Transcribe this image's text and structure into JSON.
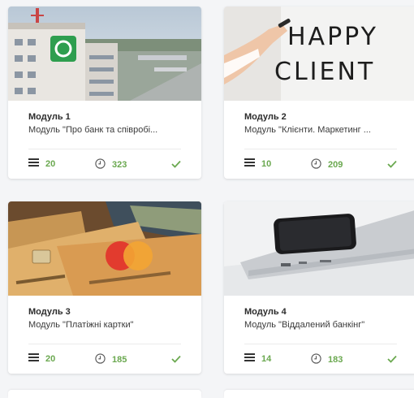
{
  "accent_color": "#6aa84f",
  "modules": [
    {
      "title": "Модуль 1",
      "subtitle": "Модуль \"Про банк та співробі...",
      "lessons": "20",
      "minutes": "323",
      "image": "bank-building-photo",
      "completed": true
    },
    {
      "title": "Модуль 2",
      "subtitle": "Модуль \"Клієнти. Маркетинг ...",
      "lessons": "10",
      "minutes": "209",
      "image": "happy-client-handwriting-photo",
      "image_text": [
        "HAPPY",
        "CLIENT"
      ],
      "completed": true
    },
    {
      "title": "Модуль 3",
      "subtitle": "Модуль \"Платіжні картки\"",
      "lessons": "20",
      "minutes": "185",
      "image": "payment-cards-photo",
      "completed": true
    },
    {
      "title": "Модуль 4",
      "subtitle": "Модуль \"Віддалений банкінг\"",
      "lessons": "14",
      "minutes": "183",
      "image": "smartphone-on-laptop-photo",
      "completed": true
    }
  ],
  "icons": {
    "lessons": "list-icon",
    "minutes": "clock-icon",
    "status": "checkmark-icon"
  }
}
